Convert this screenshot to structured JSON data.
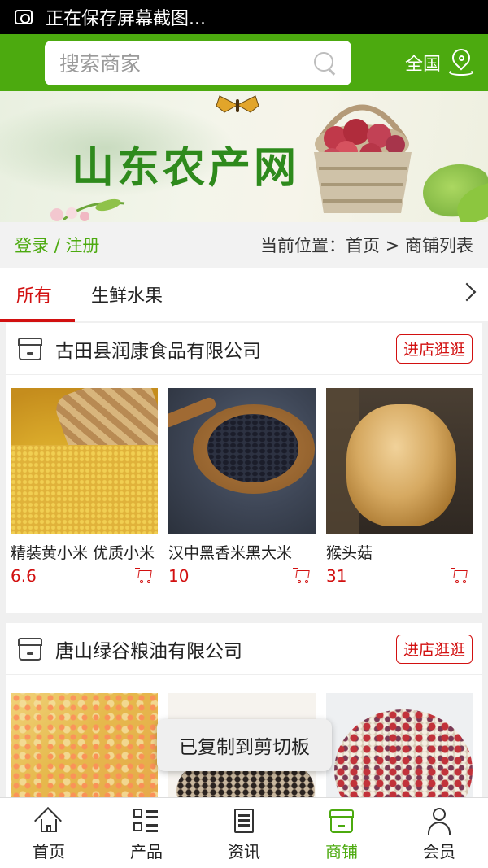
{
  "status_bar": {
    "text": "正在保存屏幕截图..."
  },
  "header": {
    "search_placeholder": "搜索商家",
    "region": "全国",
    "accent": "#4caa0f"
  },
  "banner": {
    "title": "山东农产网"
  },
  "crumbs": {
    "login": "登录 / 注册",
    "position": "当前位置：首页 > 商铺列表"
  },
  "tabs": [
    {
      "label": "所有",
      "active": true
    },
    {
      "label": "生鲜水果",
      "active": false
    }
  ],
  "shops": [
    {
      "name": "古田县润康食品有限公司",
      "visit_label": "进店逛逛",
      "products": [
        {
          "name": "精装黄小米 优质小米",
          "price": "6.6",
          "icon": "millet-image"
        },
        {
          "name": "汉中黑香米黑大米",
          "price": "10",
          "icon": "black-rice-image"
        },
        {
          "name": "猴头菇",
          "price": "31",
          "icon": "mushroom-image"
        }
      ]
    },
    {
      "name": "唐山绿谷粮油有限公司",
      "visit_label": "进店逛逛",
      "products": [
        {
          "name": "",
          "price": "",
          "icon": "yellow-grain-image"
        },
        {
          "name": "",
          "price": "",
          "icon": "beans-image"
        },
        {
          "name": "",
          "price": "",
          "icon": "mixed-grain-image"
        }
      ]
    }
  ],
  "toast": {
    "text": "已复制到剪切板"
  },
  "bottom_nav": [
    {
      "label": "首页",
      "icon": "home-icon",
      "active": false
    },
    {
      "label": "产品",
      "icon": "grid-list-icon",
      "active": false
    },
    {
      "label": "资讯",
      "icon": "news-icon",
      "active": false
    },
    {
      "label": "商铺",
      "icon": "store-icon",
      "active": true
    },
    {
      "label": "会员",
      "icon": "user-icon",
      "active": false
    }
  ],
  "colors": {
    "brand_green": "#4caa0f",
    "active_red": "#d21010"
  }
}
